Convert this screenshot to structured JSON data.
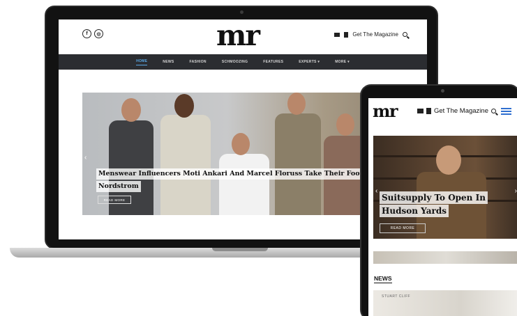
{
  "laptop_site": {
    "logo": "mr",
    "header_cta": "Get The Magazine",
    "nav": [
      "HOME",
      "NEWS",
      "FASHION",
      "SCHMOOZING",
      "FEATURES",
      "EXPERTS ▾",
      "MORE ▾"
    ],
    "hero": {
      "title_line1": "Menswear Influencers Moti Ankari And Marcel Floruss Take Their Footwear B",
      "title_line2": "Nordstrom",
      "button": "READ MORE"
    }
  },
  "tablet_site": {
    "logo": "mr",
    "header_cta": "Get The Magazine",
    "hero": {
      "title_line1": "Suitsupply To Open In",
      "title_line2": "Hudson Yards",
      "button": "READ MORE"
    },
    "section_label": "NEWS",
    "thumb_caption": "STUART CLIFF"
  },
  "colors": {
    "nav_bg": "#2b2d31",
    "nav_active": "#5aa9e6",
    "burger": "#2f6fd0"
  },
  "icons": [
    "facebook-icon",
    "instagram-icon",
    "envelope-icon",
    "book-icon",
    "search-icon",
    "menu-icon",
    "chevron-left-icon"
  ]
}
